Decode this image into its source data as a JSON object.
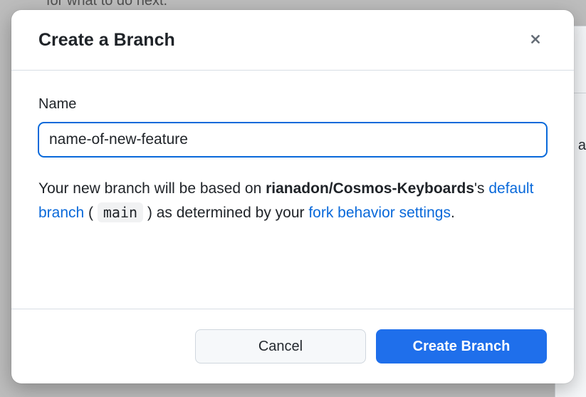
{
  "background": {
    "peek_text": "for what to do next.",
    "peek_char": "a"
  },
  "dialog": {
    "title": "Create a Branch",
    "close_icon": "close",
    "name_label": "Name",
    "name_value": "name-of-new-feature",
    "help": {
      "line1_prefix": "Your new branch will be based on ",
      "repo": "rianadon/Cosmos-Keyboards",
      "possessive": "'s ",
      "default_branch_link": "default branch",
      "open_paren": " ( ",
      "branch_code": "main",
      "close_paren": " ) as determined by your ",
      "fork_settings_link": "fork behavior settings",
      "period": "."
    },
    "cancel_label": "Cancel",
    "submit_label": "Create Branch"
  }
}
